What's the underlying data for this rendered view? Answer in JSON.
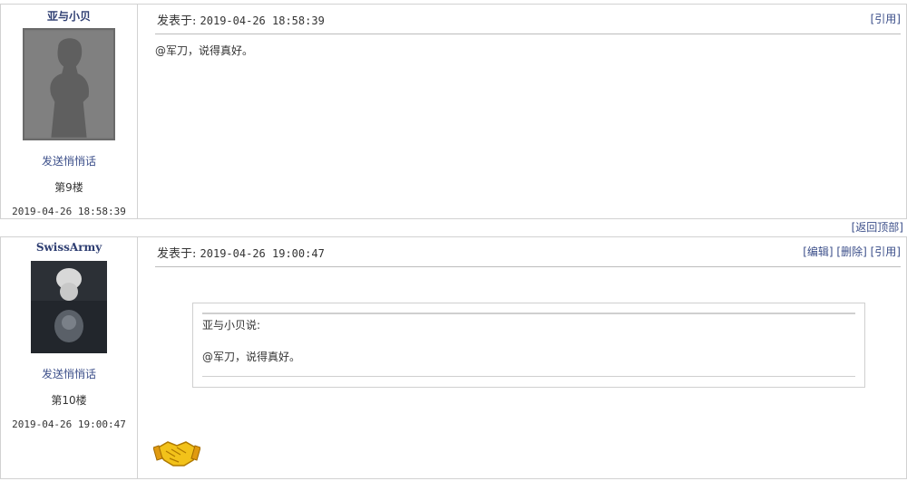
{
  "posts": [
    {
      "username": "亚与小贝",
      "send_message": "发送悄悄话",
      "floor": "第9楼",
      "time": "2019-04-26 18:58:39",
      "posted_label": "发表于:",
      "posted_time": "2019-04-26 18:58:39",
      "actions": {
        "quote": "[引用]"
      },
      "content": "@军刀，说得真好。"
    },
    {
      "username": "SwissArmy",
      "send_message": "发送悄悄话",
      "floor": "第10楼",
      "time": "2019-04-26 19:00:47",
      "posted_label": "发表于:",
      "posted_time": "2019-04-26 19:00:47",
      "actions": {
        "edit": "[编辑]",
        "delete": "[删除]",
        "quote": "[引用]"
      },
      "quote_block": {
        "header": "亚与小贝说:",
        "body": "@军刀，说得真好。"
      },
      "emoji": "handshake-icon"
    }
  ],
  "back_to_top": "[返回顶部]",
  "colors": {
    "link": "#3c4f8a",
    "border": "#d2d2d2"
  }
}
